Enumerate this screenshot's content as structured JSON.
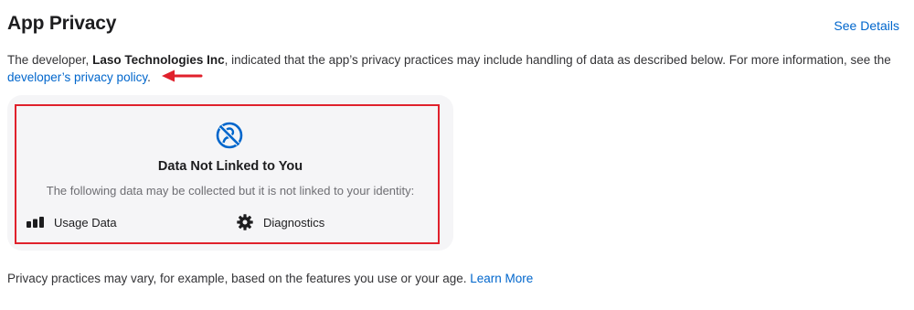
{
  "header": {
    "title": "App Privacy",
    "see_details": "See Details"
  },
  "description": {
    "prefix": "The developer, ",
    "developer_name": "Laso Technologies Inc",
    "middle": ", indicated that the app’s privacy practices may include handling of data as described below. For more information, see the",
    "policy_link": "developer’s privacy policy",
    "suffix": "."
  },
  "card": {
    "icon": "not-linked-icon",
    "title": "Data Not Linked to You",
    "subtitle": "The following data may be collected but it is not linked to your identity:",
    "categories": [
      {
        "icon": "usage-data-icon",
        "label": "Usage Data"
      },
      {
        "icon": "gear-icon",
        "label": "Diagnostics"
      }
    ]
  },
  "footer": {
    "text": "Privacy practices may vary, for example, based on the features you use or your age.",
    "learn_more": "Learn More"
  },
  "colors": {
    "link": "#0066cc",
    "annotation_red": "#e0212c",
    "card_background": "#f5f5f7"
  }
}
